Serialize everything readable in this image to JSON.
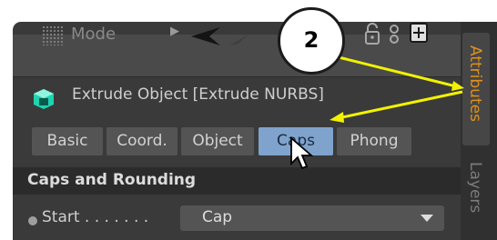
{
  "toolbar": {
    "mode_label": "Mode",
    "icons": [
      "grip-icon",
      "play-arrow-icon",
      "back-arrow-icon",
      "forward-arrow-icon",
      "lock-icon",
      "hierarchy-icon",
      "new-panel-icon"
    ]
  },
  "object": {
    "icon": "cube-icon",
    "title": "Extrude Object [Extrude NURBS]"
  },
  "tabs": [
    {
      "label": "Basic",
      "active": false
    },
    {
      "label": "Coord.",
      "active": false
    },
    {
      "label": "Object",
      "active": false
    },
    {
      "label": "Caps",
      "active": true
    },
    {
      "label": "Phong",
      "active": false
    }
  ],
  "section": {
    "title": "Caps and Rounding"
  },
  "fields": {
    "start": {
      "label": "Start . . . . . . .",
      "value": "Cap"
    }
  },
  "side_tabs": [
    {
      "label": "Attributes",
      "active": true
    },
    {
      "label": "Layers",
      "active": false
    }
  ],
  "annotation": {
    "badge": "2"
  },
  "colors": {
    "panel": "#3a3a3a",
    "active_tab": "#7fa3cc",
    "attributes_accent": "#e0901c",
    "annotation_arrow": "#f2f200"
  }
}
